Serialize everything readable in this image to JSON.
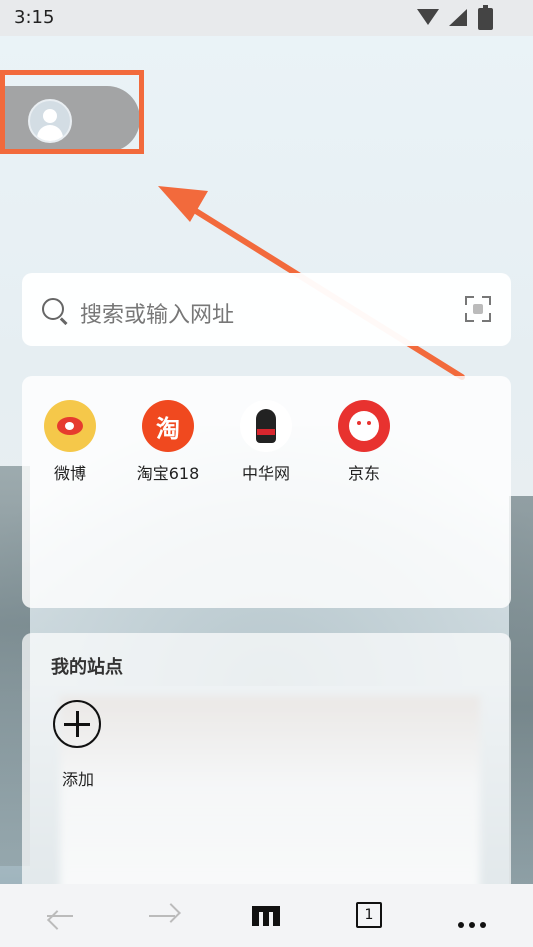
{
  "status_bar": {
    "time": "3:15"
  },
  "search": {
    "placeholder": "搜索或输入网址"
  },
  "quick_links": [
    {
      "label": "微博",
      "icon": "weibo-icon"
    },
    {
      "label": "淘宝618",
      "icon": "taobao-icon",
      "glyph": "淘"
    },
    {
      "label": "中华网",
      "icon": "zhonghua-icon"
    },
    {
      "label": "京东",
      "icon": "jd-icon"
    }
  ],
  "my_sites": {
    "title": "我的站点",
    "add_label": "添加"
  },
  "bottom_nav": {
    "tab_count": "1"
  },
  "colors": {
    "highlight": "#f26a3c",
    "weibo": "#f5c84a",
    "taobao": "#f0491f",
    "jd": "#e8322f"
  }
}
